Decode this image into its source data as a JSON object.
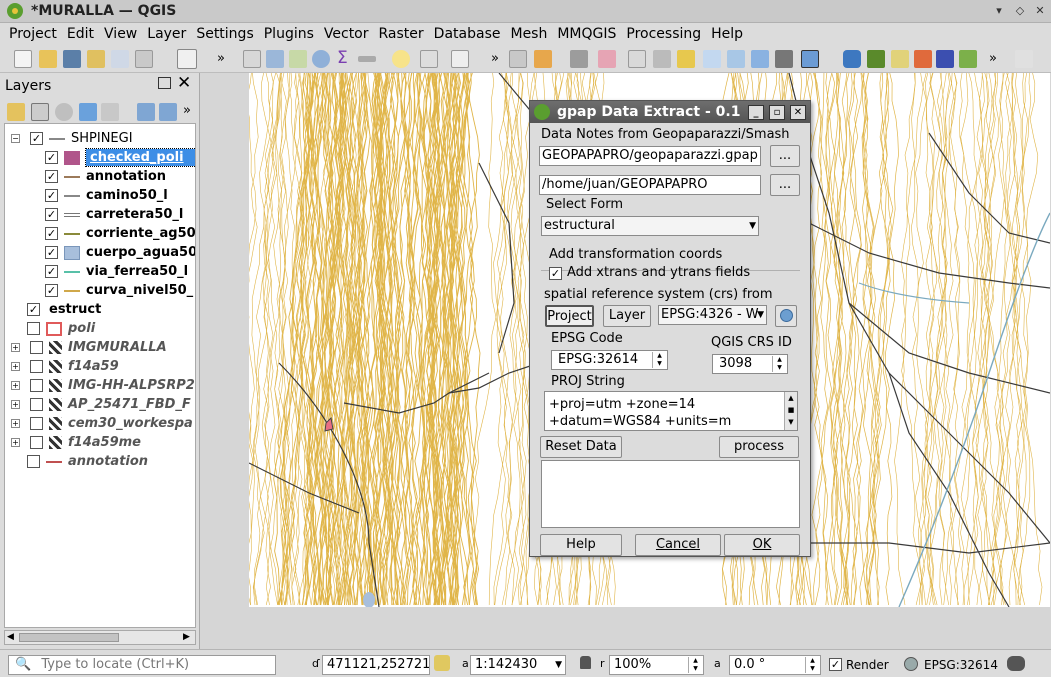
{
  "window": {
    "title": "*MURALLA — QGIS",
    "controls": [
      "▾",
      "◇",
      "✕"
    ]
  },
  "menubar": [
    "Project",
    "Edit",
    "View",
    "Layer",
    "Settings",
    "Plugins",
    "Vector",
    "Raster",
    "Database",
    "Mesh",
    "MMQGIS",
    "Processing",
    "Help"
  ],
  "layers_panel": {
    "title": "Layers",
    "items": [
      {
        "label": "SHPINEGI",
        "checked": true,
        "expanded": true,
        "style": "group"
      },
      {
        "label": "checked_poli",
        "checked": true,
        "style": "selected",
        "symbol": "fill-purple"
      },
      {
        "label": "annotation",
        "checked": true,
        "style": "bold",
        "symbol": "line-brown"
      },
      {
        "label": "camino50_l",
        "checked": true,
        "style": "bold",
        "symbol": "line-gray"
      },
      {
        "label": "carretera50_l",
        "checked": true,
        "style": "bold",
        "symbol": "line-double"
      },
      {
        "label": "corriente_ag50",
        "checked": true,
        "style": "bold",
        "symbol": "line-olive"
      },
      {
        "label": "cuerpo_agua50",
        "checked": true,
        "style": "bold",
        "symbol": "fill-blue"
      },
      {
        "label": "via_ferrea50_l",
        "checked": true,
        "style": "bold",
        "symbol": "line-teal"
      },
      {
        "label": "curva_nivel50_",
        "checked": true,
        "style": "bold",
        "symbol": "line-gold"
      },
      {
        "label": "estruct",
        "checked": true,
        "style": "bold",
        "symbol": "none"
      },
      {
        "label": "poli",
        "checked": false,
        "style": "italic",
        "symbol": "fill-outline-red"
      },
      {
        "label": "IMGMURALLA",
        "checked": false,
        "style": "italic",
        "symbol": "raster"
      },
      {
        "label": "f14a59",
        "checked": false,
        "style": "italic",
        "symbol": "raster"
      },
      {
        "label": "IMG-HH-ALPSRP2",
        "checked": false,
        "style": "italic",
        "symbol": "raster"
      },
      {
        "label": "AP_25471_FBD_F",
        "checked": false,
        "style": "italic",
        "symbol": "raster"
      },
      {
        "label": "cem30_workespa",
        "checked": false,
        "style": "italic",
        "symbol": "raster"
      },
      {
        "label": "f14a59me",
        "checked": false,
        "style": "italic",
        "symbol": "raster"
      },
      {
        "label": "annotation",
        "checked": false,
        "style": "italic",
        "symbol": "line-red"
      }
    ]
  },
  "dialog": {
    "title": "gpap Data Extract - 0.1",
    "notes_label": "Data Notes from Geopaparazzi/Smash",
    "gpap_path": "GEOPAPAPRO/geopaparazzi.gpap",
    "output_path": "/home/juan/GEOPAPAPRO",
    "browse": "...",
    "select_form_label": "Select Form",
    "form_value": "estructural",
    "transform_label": "Add transformation coords",
    "xy_checkbox_label": "Add xtrans and ytrans fields",
    "crs_label": "spatial reference system (crs) from",
    "project_btn": "Project",
    "layer_btn": "Layer",
    "crs_select": "EPSG:4326 - W",
    "epsg_label": "EPSG Code",
    "epsg_value": "EPSG:32614",
    "qgis_crs_label": "QGIS CRS ID",
    "qgis_crs_value": "3098",
    "proj_label": "PROJ String",
    "proj_line1": "+proj=utm +zone=14",
    "proj_line2": "+datum=WGS84 +units=m",
    "reset_btn": "Reset Data",
    "process_btn": "process",
    "help_btn": "Help",
    "cancel_btn": "Cancel",
    "ok_btn": "OK"
  },
  "statusbar": {
    "locator_placeholder": "Type to locate (Ctrl+K)",
    "coordinate": "471121,2527213",
    "scale": "1:142430",
    "magnifier": "100%",
    "rotation": "0.0 °",
    "render_label": "Render",
    "crs": "EPSG:32614"
  },
  "colors": {
    "contour": "#e0b548",
    "road": "#3a3a3a",
    "water": "#7aa9bf",
    "selection": "#3d8ee6"
  }
}
